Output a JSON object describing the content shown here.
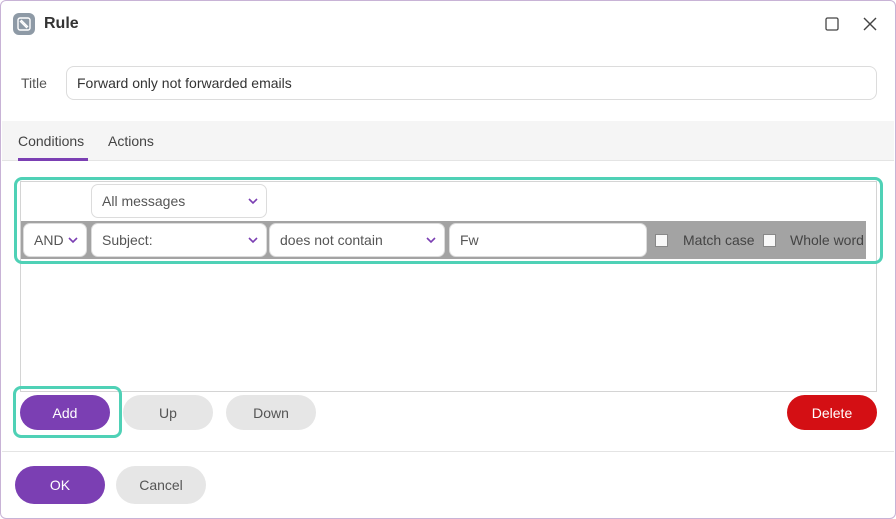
{
  "window": {
    "title": "Rule",
    "icon": "rule-app-icon",
    "controls": {
      "maximize_icon": "maximize-icon",
      "close_icon": "close-icon"
    }
  },
  "title_field": {
    "label": "Title",
    "value": "Forward only not forwarded emails"
  },
  "tabs": [
    {
      "label": "Conditions",
      "active": true
    },
    {
      "label": "Actions",
      "active": false
    }
  ],
  "conditions": {
    "scope": "All messages",
    "rows": [
      {
        "join": "AND",
        "field": "Subject:",
        "operator": "does not contain",
        "value": "Fw",
        "match_case_label": "Match case",
        "match_case": false,
        "whole_word_label": "Whole word",
        "whole_word": false
      }
    ]
  },
  "condition_buttons": {
    "add": "Add",
    "up": "Up",
    "down": "Down",
    "delete": "Delete"
  },
  "footer": {
    "ok": "OK",
    "cancel": "Cancel"
  },
  "colors": {
    "accent": "#7b3fb3",
    "danger": "#d40f14",
    "highlight": "#4fd1b6",
    "row_background": "#a3a3a3"
  }
}
